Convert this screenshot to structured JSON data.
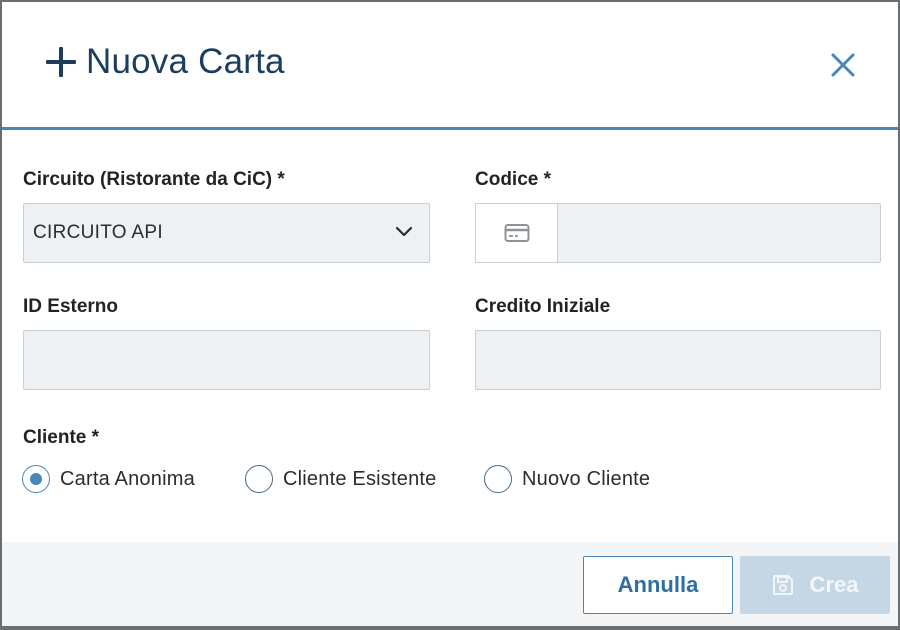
{
  "modal": {
    "title": "Nuova Carta",
    "fields": {
      "circuito": {
        "label": "Circuito (Ristorante da CiC) *",
        "value": "CIRCUITO API"
      },
      "codice": {
        "label": "Codice *",
        "value": ""
      },
      "id_esterno": {
        "label": "ID Esterno",
        "value": ""
      },
      "credito_iniziale": {
        "label": "Credito Iniziale",
        "value": ""
      }
    },
    "cliente": {
      "label": "Cliente *",
      "options": [
        {
          "label": "Carta Anonima",
          "checked": true
        },
        {
          "label": "Cliente Esistente",
          "checked": false
        },
        {
          "label": "Nuovo Cliente",
          "checked": false
        }
      ]
    },
    "footer": {
      "cancel_label": "Annulla",
      "create_label": "Crea"
    }
  },
  "icons": {
    "title": "plus-icon",
    "close": "close-icon",
    "select": "chevron-down-icon",
    "codice": "credit-card-icon",
    "create": "save-icon"
  },
  "colors": {
    "primary": "#4a87b9",
    "title": "#1b3e5e",
    "input_bg": "#eef1f4",
    "disabled_button": "#c5d6e5"
  }
}
